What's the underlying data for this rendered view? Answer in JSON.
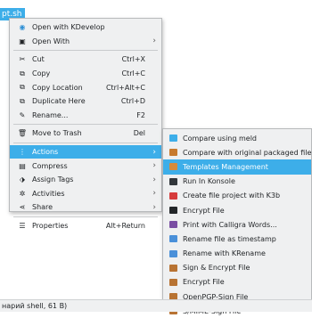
{
  "file_label": "pt.sh",
  "status_text": "нарий shell, 61 B)",
  "main_menu": {
    "items": [
      {
        "label": "Open with KDevelop",
        "shortcut": "",
        "icon": "kdevelop-icon",
        "glyph": "◉",
        "color": "#2d8fd5"
      },
      {
        "label": "Open With",
        "shortcut": "",
        "icon": "open-with-icon",
        "glyph": "▣",
        "color": "#232629",
        "arrow": "›"
      },
      {
        "label": "Cut",
        "shortcut": "Ctrl+X",
        "icon": "scissors-icon",
        "glyph": "✂",
        "color": "#232629"
      },
      {
        "label": "Copy",
        "shortcut": "Ctrl+C",
        "icon": "copy-icon",
        "glyph": "⧉",
        "color": "#232629"
      },
      {
        "label": "Copy Location",
        "shortcut": "Ctrl+Alt+C",
        "icon": "copy-location-icon",
        "glyph": "⧉",
        "color": "#232629"
      },
      {
        "label": "Duplicate Here",
        "shortcut": "Ctrl+D",
        "icon": "duplicate-icon",
        "glyph": "⧉",
        "color": "#232629"
      },
      {
        "label": "Rename...",
        "shortcut": "F2",
        "icon": "rename-icon",
        "glyph": "✎",
        "color": "#232629"
      },
      {
        "label": "Move to Trash",
        "shortcut": "Del",
        "icon": "trash-icon",
        "glyph": "🗑",
        "color": "#232629"
      },
      {
        "label": "Actions",
        "shortcut": "",
        "icon": "actions-icon",
        "glyph": "⋮",
        "color": "#ffffff",
        "arrow": "›",
        "highlighted": true
      },
      {
        "label": "Compress",
        "shortcut": "",
        "icon": "compress-icon",
        "glyph": "▤",
        "color": "#232629",
        "arrow": "›"
      },
      {
        "label": "Assign Tags",
        "shortcut": "",
        "icon": "tag-icon",
        "glyph": "⬗",
        "color": "#232629",
        "arrow": "›"
      },
      {
        "label": "Activities",
        "shortcut": "",
        "icon": "activities-icon",
        "glyph": "✲",
        "color": "#232629",
        "arrow": "›"
      },
      {
        "label": "Share",
        "shortcut": "",
        "icon": "share-icon",
        "glyph": "⋖",
        "color": "#232629",
        "arrow": "›"
      },
      {
        "label": "Properties",
        "shortcut": "Alt+Return",
        "icon": "properties-icon",
        "glyph": "☰",
        "color": "#232629"
      }
    ]
  },
  "sub_menu": {
    "items": [
      {
        "label": "Compare using meld",
        "icon": "meld-icon",
        "color": "#3daee9"
      },
      {
        "label": "Compare with original packaged file",
        "icon": "package-compare-icon",
        "color": "#c77a2e"
      },
      {
        "label": "Templates Management",
        "icon": "templates-icon",
        "color": "#d58a3a",
        "highlighted": true
      },
      {
        "label": "Run In Konsole",
        "icon": "konsole-icon",
        "color": "#31363b"
      },
      {
        "label": "Create file project with K3b",
        "icon": "k3b-icon",
        "color": "#d63b3b"
      },
      {
        "label": "Encrypt File",
        "icon": "lock-icon",
        "color": "#232629"
      },
      {
        "label": "Print with Calligra Words...",
        "icon": "calligra-icon",
        "color": "#7a4ea3"
      },
      {
        "label": "Rename file as timestamp",
        "icon": "timestamp-icon",
        "color": "#4a90d9"
      },
      {
        "label": "Rename with KRename",
        "icon": "krename-icon",
        "color": "#4a90d9"
      },
      {
        "label": "Sign & Encrypt File",
        "icon": "sign-encrypt-icon",
        "color": "#b87333"
      },
      {
        "label": "Encrypt File",
        "icon": "encrypt-icon",
        "color": "#b87333"
      },
      {
        "label": "OpenPGP-Sign File",
        "icon": "openpgp-icon",
        "color": "#b87333"
      },
      {
        "label": "S/MIME-Sign File",
        "icon": "smime-icon",
        "color": "#b87333"
      }
    ]
  }
}
